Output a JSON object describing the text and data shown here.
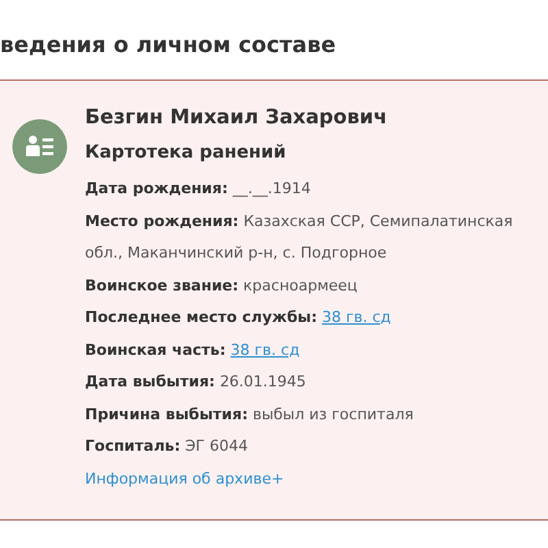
{
  "section_title": "ведения о личном составе",
  "card": {
    "name": "Безгин Михаил Захарович",
    "source": "Картотека ранений",
    "fields": [
      {
        "label": "Дата рождения:",
        "value": "__.__.1914",
        "kind": "text"
      },
      {
        "label": "Место рождения:",
        "value": "Казахская ССР, Семипалатинская обл., Маканчинский р-н, с. Подгорное",
        "kind": "text"
      },
      {
        "label": "Воинское звание:",
        "value": "красноармеец",
        "kind": "text"
      },
      {
        "label": "Последнее место службы:",
        "value": "38 гв. сд",
        "kind": "link"
      },
      {
        "label": "Воинская часть:",
        "value": "38 гв. сд",
        "kind": "link"
      },
      {
        "label": "Дата выбытия:",
        "value": "26.01.1945",
        "kind": "text"
      },
      {
        "label": "Причина выбытия:",
        "value": "выбыл из госпиталя",
        "kind": "text"
      },
      {
        "label": "Госпиталь:",
        "value": "ЭГ 6044",
        "kind": "text"
      }
    ],
    "archive_link": "Информация об архиве+"
  }
}
